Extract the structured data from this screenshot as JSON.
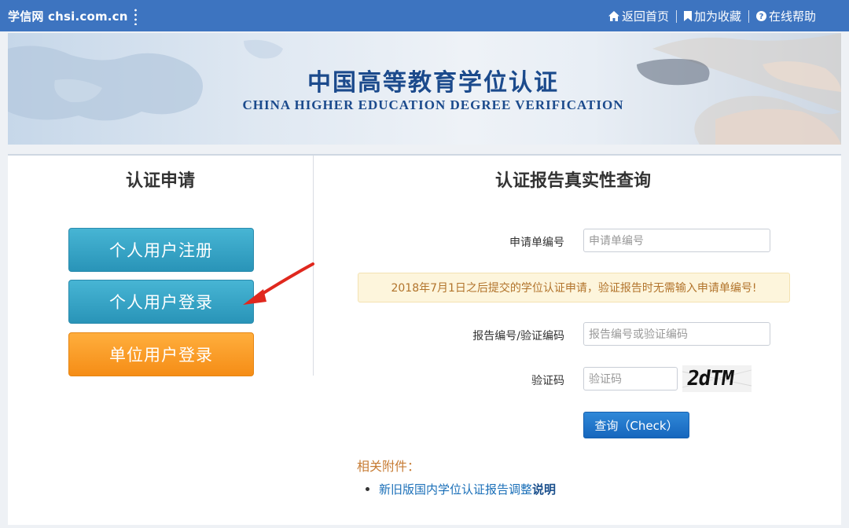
{
  "topbar": {
    "brand": "学信网 chsi.com.cn",
    "links": [
      {
        "icon": "home-icon",
        "label": "返回首页"
      },
      {
        "icon": "bookmark-icon",
        "label": "加为收藏"
      },
      {
        "icon": "help-icon",
        "label": "在线帮助"
      }
    ]
  },
  "banner": {
    "title_cn": "中国高等教育学位认证",
    "title_en": "CHINA HIGHER EDUCATION DEGREE VERIFICATION"
  },
  "left": {
    "title": "认证申请",
    "buttons": [
      "个人用户注册",
      "个人用户登录",
      "单位用户登录"
    ]
  },
  "right": {
    "title": "认证报告真实性查询",
    "application_no": {
      "label": "申请单编号",
      "placeholder": "申请单编号"
    },
    "notice": "2018年7月1日之后提交的学位认证申请，验证报告时无需输入申请单编号!",
    "report_no": {
      "label": "报告编号/验证编码",
      "placeholder": "报告编号或验证编码"
    },
    "captcha": {
      "label": "验证码",
      "placeholder": "验证码",
      "image_text": "2dTM"
    },
    "check_label": "查询（Check）",
    "attachments_title": "相关附件：",
    "attachment_link": "新旧版国内学位认证报告调整",
    "attachment_link_strong": "说明"
  },
  "colors": {
    "topbar": "#3d74c0",
    "primary_button": "#2994b8",
    "company_button": "#f58d16",
    "check_button": "#1666bd",
    "notice_bg": "#fdf5dc",
    "arrow": "#e0281e"
  }
}
